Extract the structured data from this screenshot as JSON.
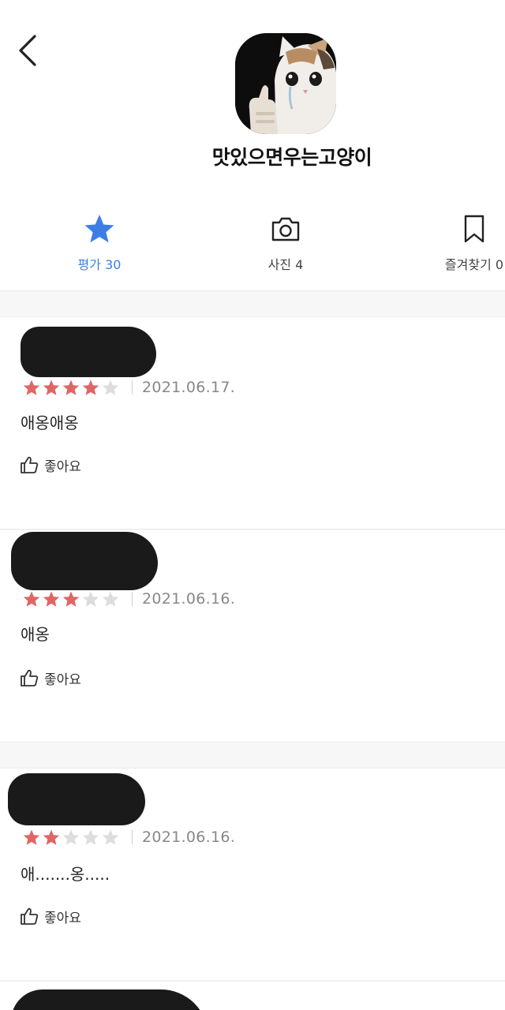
{
  "profile": {
    "name": "맛있으면우는고양이"
  },
  "tabs": [
    {
      "label": "평가 30",
      "icon": "star-icon",
      "active": true
    },
    {
      "label": "사진 4",
      "icon": "camera-icon",
      "active": false
    },
    {
      "label": "즐겨찾기 0",
      "icon": "bookmark-icon",
      "active": false
    }
  ],
  "reviews": [
    {
      "rating": 4,
      "date": "2021.06.17.",
      "text": "애옹애옹",
      "like_label": "좋아요"
    },
    {
      "rating": 3,
      "date": "2021.06.16.",
      "text": "애옹",
      "like_label": "좋아요"
    },
    {
      "rating": 2,
      "date": "2021.06.16.",
      "text": "애.......옹.....",
      "like_label": "좋아요"
    }
  ],
  "colors": {
    "accent": "#3d7ee6",
    "star_filled": "#e06666",
    "star_empty": "#dddddd"
  }
}
